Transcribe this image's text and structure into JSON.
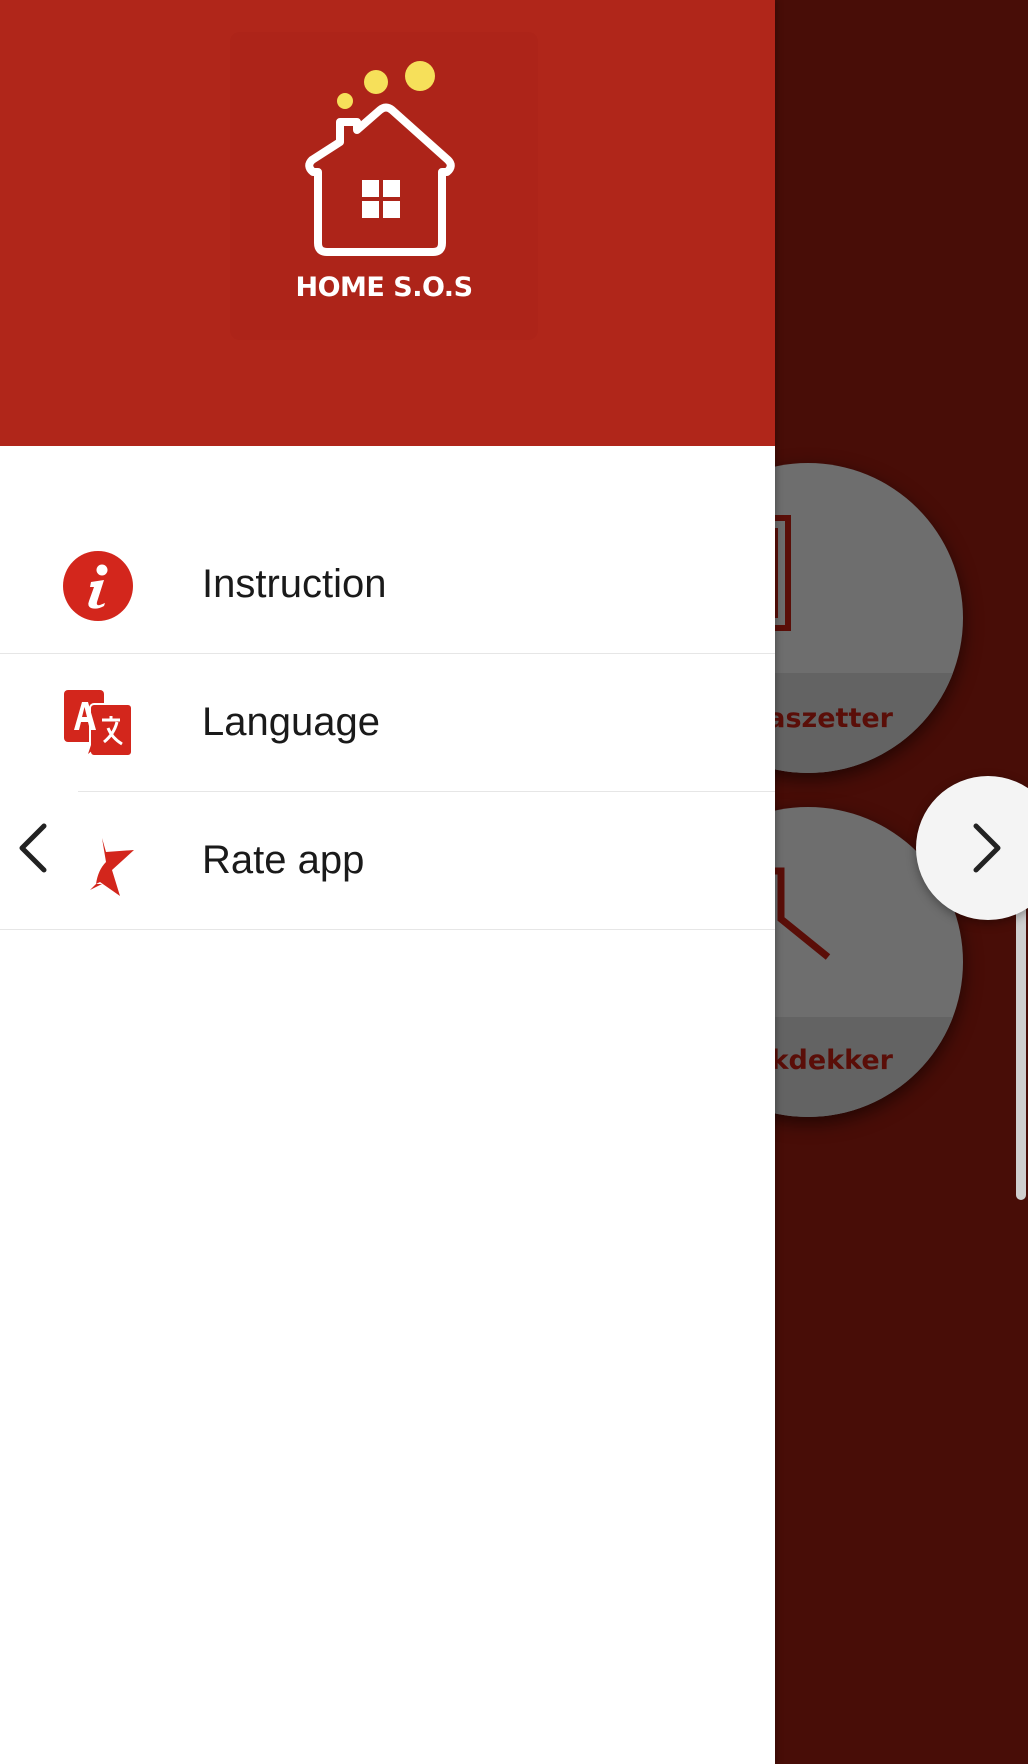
{
  "app": {
    "logo_text": "HOME S.O.S"
  },
  "drawer": {
    "items": [
      {
        "label": "Instruction",
        "icon": "info-icon"
      },
      {
        "label": "Language",
        "icon": "translate-icon"
      },
      {
        "label": "Rate app",
        "icon": "rate-flag-icon"
      }
    ]
  },
  "background": {
    "tiles": [
      {
        "caption": "aszetter",
        "icon": "broken-window-icon"
      },
      {
        "caption": "kdekker",
        "icon": "roof-icon"
      }
    ]
  },
  "colors": {
    "brand_red": "#b0261a",
    "background_dark": "#490d07",
    "accent_yellow": "#f6e05a"
  }
}
